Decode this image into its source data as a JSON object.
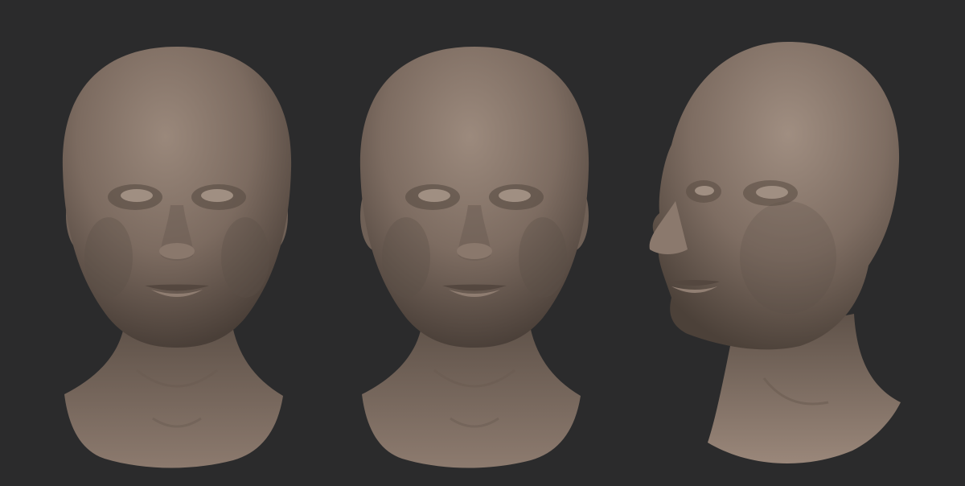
{
  "scene": {
    "background_color": "#2b2b2c",
    "material_color": "#7f6e63",
    "renders": [
      {
        "view": "front"
      },
      {
        "view": "front"
      },
      {
        "view": "three-quarter-left"
      }
    ]
  }
}
